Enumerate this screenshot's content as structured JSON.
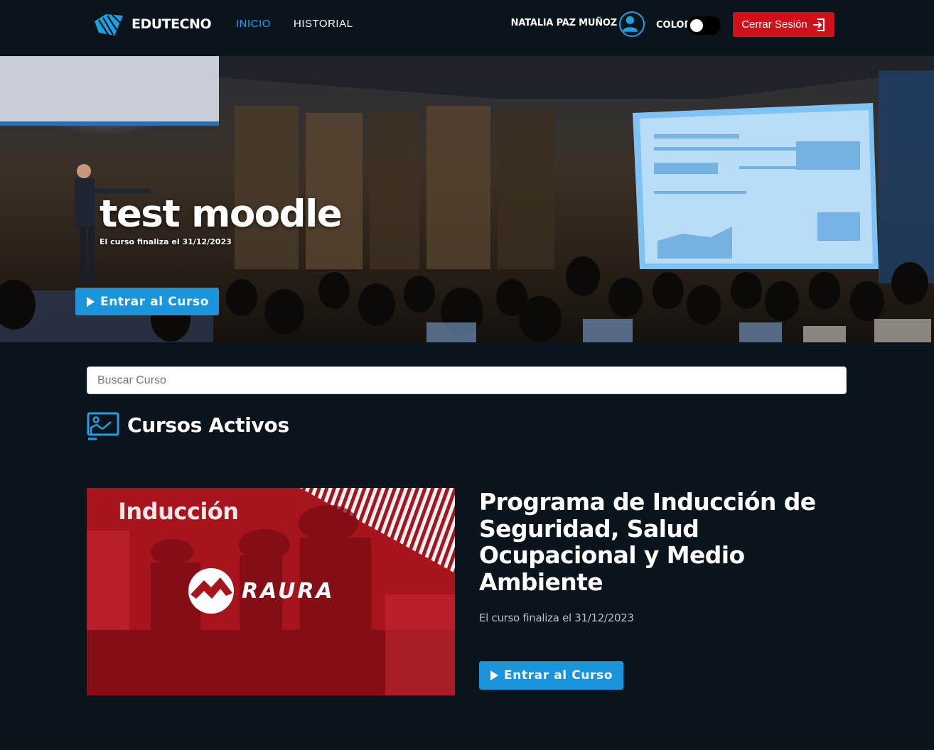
{
  "header": {
    "logo_text": "EDUTECNO",
    "nav": [
      {
        "label": "INICIO",
        "active": true
      },
      {
        "label": "HISTORIAL",
        "active": false
      }
    ],
    "user_name": "NATALIA PAZ MUÑOZ",
    "color_label": "COLOR",
    "color_toggle_on": false,
    "logout_label": "Cerrar Sesión"
  },
  "hero": {
    "title": "test moodle",
    "subtitle": "El curso finaliza el 31/12/2023",
    "button_label": "Entrar al Curso"
  },
  "search": {
    "placeholder": "Buscar Curso",
    "value": ""
  },
  "section": {
    "title": "Cursos Activos"
  },
  "courses": [
    {
      "image_label": "Inducción",
      "image_brand": "RAURA",
      "title": "Programa de Inducción de Seguridad, Salud Ocupacional y Medio Ambiente",
      "end_date": "El curso finaliza el 31/12/2023",
      "button_label": "Entrar al Curso"
    }
  ],
  "colors": {
    "background": "#0a141c",
    "accent": "#1ea0e6",
    "button_blue": "#1a95db",
    "logout_red": "#d0101a",
    "card_red": "#a8141e"
  },
  "icons": [
    "edutecno-logo-icon",
    "user-avatar-icon",
    "logout-icon",
    "play-icon",
    "course-board-icon",
    "raura-logo-icon"
  ]
}
